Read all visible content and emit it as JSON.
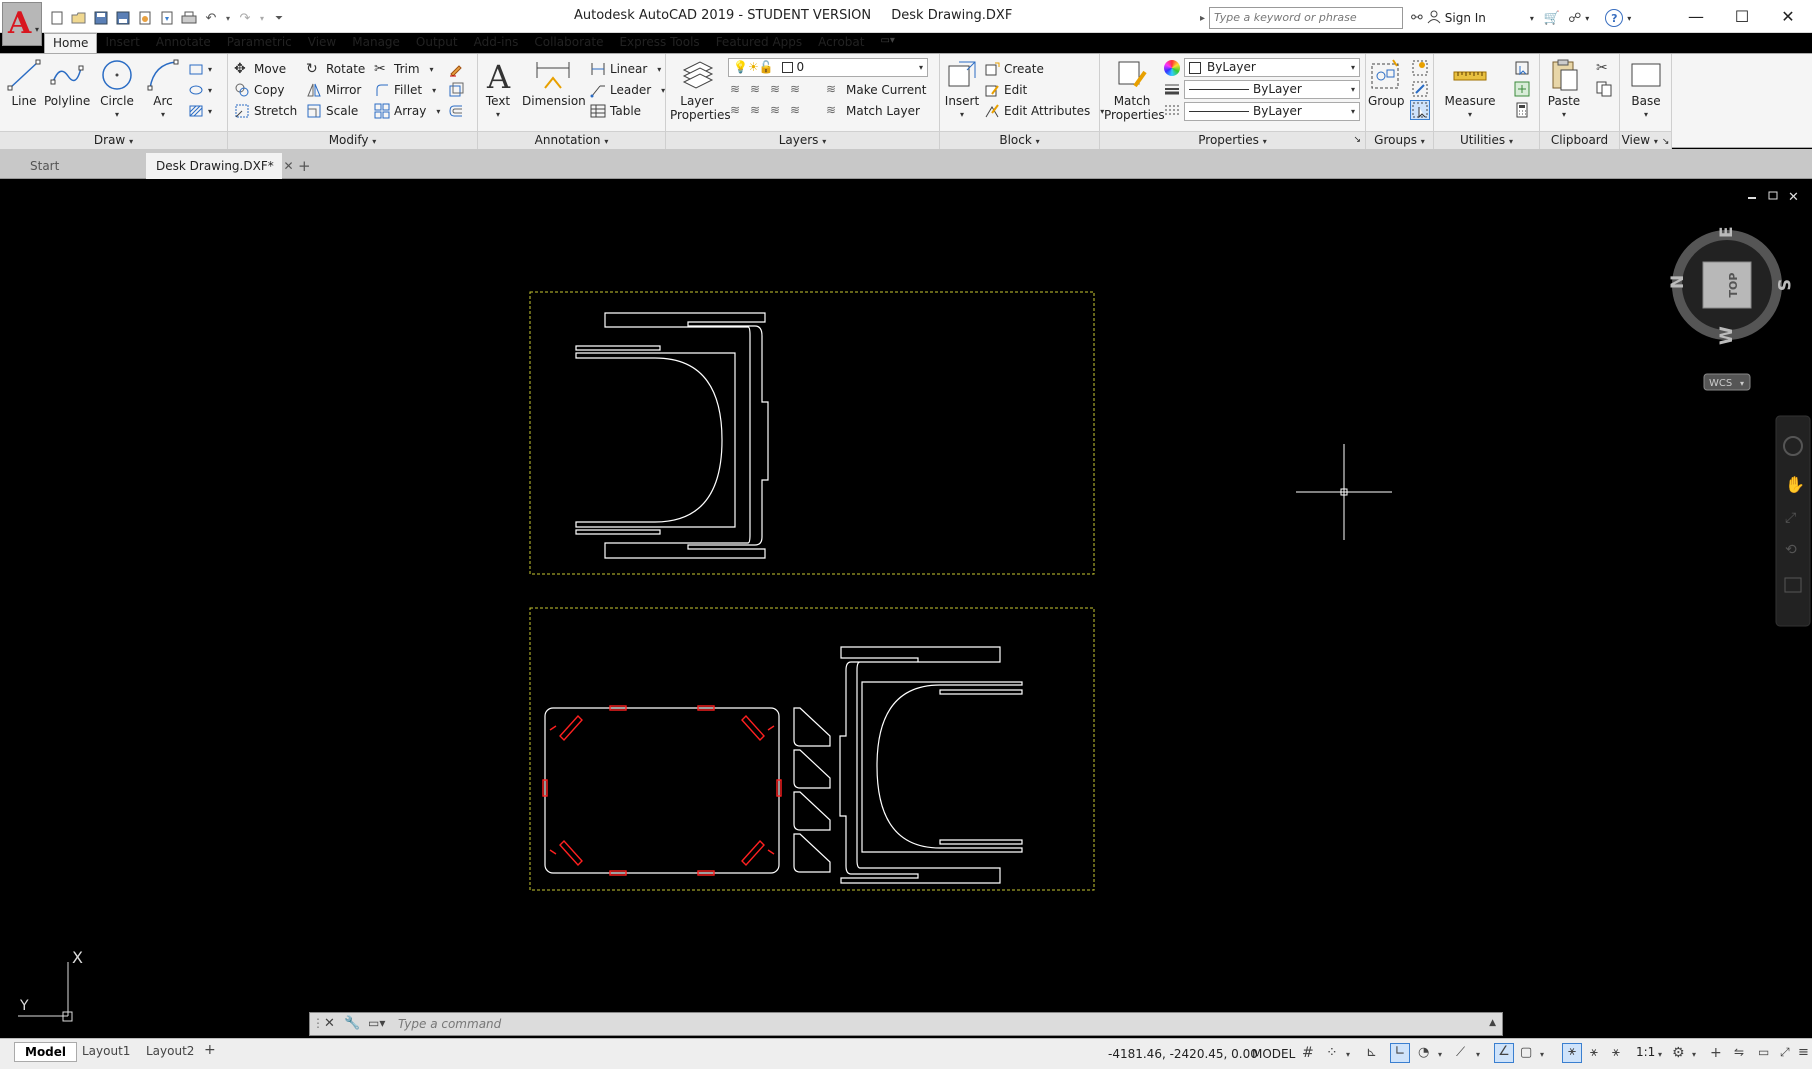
{
  "titlebar": {
    "app_title": "Autodesk AutoCAD 2019 - STUDENT VERSION",
    "document_title": "Desk Drawing.DXF",
    "search_placeholder": "Type a keyword or phrase",
    "sign_in": "Sign In"
  },
  "menu_tabs": [
    "Home",
    "Insert",
    "Annotate",
    "Parametric",
    "View",
    "Manage",
    "Output",
    "Add-ins",
    "Collaborate",
    "Express Tools",
    "Featured Apps",
    "Acrobat"
  ],
  "ribbon": {
    "draw": {
      "title": "Draw",
      "line": "Line",
      "polyline": "Polyline",
      "circle": "Circle",
      "arc": "Arc"
    },
    "modify": {
      "title": "Modify",
      "move": "Move",
      "rotate": "Rotate",
      "trim": "Trim",
      "copy": "Copy",
      "mirror": "Mirror",
      "fillet": "Fillet",
      "stretch": "Stretch",
      "scale": "Scale",
      "array": "Array"
    },
    "annotation": {
      "title": "Annotation",
      "text": "Text",
      "dimension": "Dimension",
      "linear": "Linear",
      "leader": "Leader",
      "table": "Table"
    },
    "layers": {
      "title": "Layers",
      "layer_properties_1": "Layer",
      "layer_properties_2": "Properties",
      "layer_current": "0",
      "make_current": "Make Current",
      "match_layer": "Match Layer"
    },
    "block": {
      "title": "Block",
      "insert": "Insert",
      "create": "Create",
      "edit": "Edit",
      "edit_attributes": "Edit Attributes"
    },
    "properties": {
      "title": "Properties",
      "match_1": "Match",
      "match_2": "Properties",
      "color": "ByLayer",
      "linetype": "ByLayer",
      "lineweight": "ByLayer"
    },
    "groups": {
      "title": "Groups",
      "group": "Group"
    },
    "utilities": {
      "title": "Utilities",
      "measure": "Measure"
    },
    "clipboard": {
      "title": "Clipboard",
      "paste": "Paste"
    },
    "view": {
      "title": "View",
      "base": "Base"
    }
  },
  "doc_tabs": {
    "start": "Start",
    "drawing": "Desk Drawing.DXF*"
  },
  "viewcube": {
    "face": "TOP",
    "north": "N",
    "south": "S",
    "east": "E",
    "west": "W",
    "wcs": "WCS"
  },
  "ucs": {
    "x": "X",
    "y": "Y"
  },
  "command": {
    "placeholder": "Type a command"
  },
  "status": {
    "layout_tabs": [
      "Model",
      "Layout1",
      "Layout2"
    ],
    "coordinates": "-4181.46, -2420.45, 0.00",
    "model": "MODEL",
    "scale": "1:1"
  },
  "colors": {
    "accent": "#d8161f",
    "sheet_border": "#c8c832",
    "geometry": "#ffffff",
    "tabs_red": "#ff2020"
  }
}
